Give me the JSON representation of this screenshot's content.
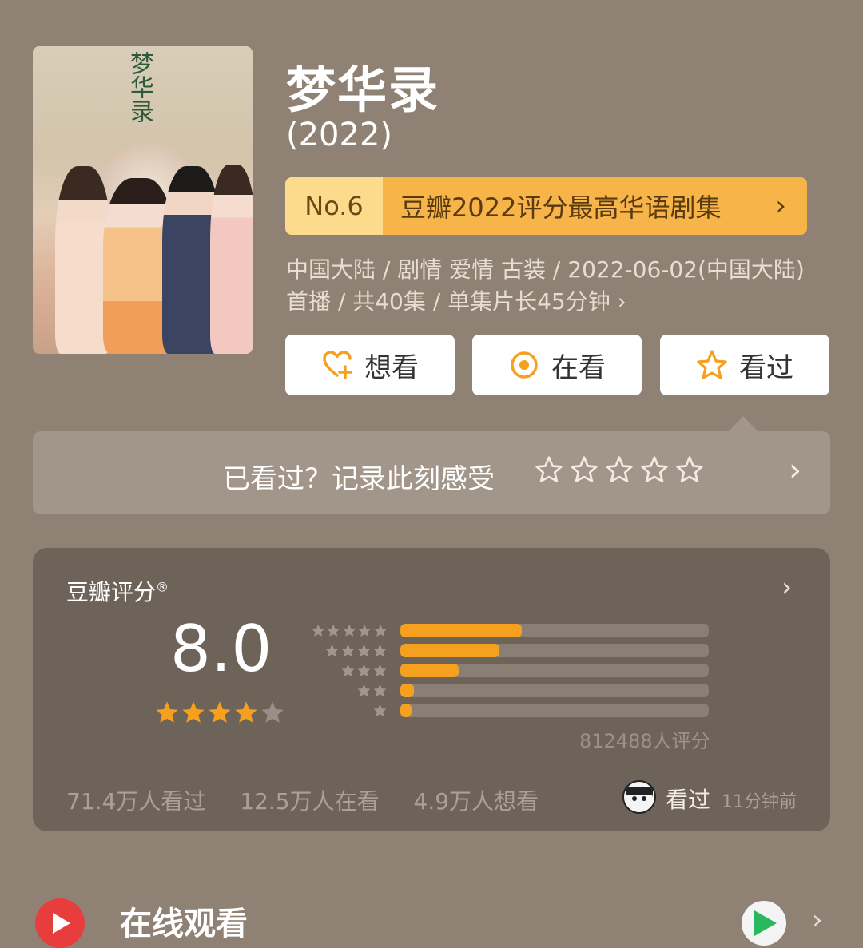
{
  "movie": {
    "title": "梦华录",
    "year": "(2022)",
    "poster_title": "梦华录"
  },
  "ranking": {
    "number": "No.6",
    "label": "豆瓣2022评分最高华语剧集",
    "chevron": "›"
  },
  "meta": {
    "line1": "中国大陆 / 剧情 爱情 古装 / 2022-06-02(中国大陆)",
    "line2": "首播 / 共40集 / 单集片长45分钟 ›"
  },
  "actions": [
    {
      "label": "想看",
      "icon": "heart-plus-icon"
    },
    {
      "label": "在看",
      "icon": "target-icon"
    },
    {
      "label": "看过",
      "icon": "star-outline-icon"
    }
  ],
  "record": {
    "prompt": "已看过？记录此刻感受",
    "star_count": 5
  },
  "rating": {
    "label": "豆瓣评分",
    "mark": "®",
    "score": "8.0",
    "stars_filled": 4,
    "distribution": [
      {
        "stars": 5,
        "fraction": 0.395
      },
      {
        "stars": 4,
        "fraction": 0.32
      },
      {
        "stars": 3,
        "fraction": 0.19
      },
      {
        "stars": 2,
        "fraction": 0.045
      },
      {
        "stars": 1,
        "fraction": 0.035
      }
    ],
    "votes": "812488人评分",
    "stats": [
      "71.4万人看过",
      "12.5万人在看",
      "4.9万人想看"
    ],
    "friend_action": "看过",
    "friend_time": "11分钟前"
  },
  "online": {
    "title": "在线观看"
  },
  "colors": {
    "background": "#8f8274",
    "accent_orange": "#f5a01e",
    "rank_light": "#fddb8c",
    "rank_dark": "#f7b448",
    "star_gold": "#f5a01e"
  }
}
